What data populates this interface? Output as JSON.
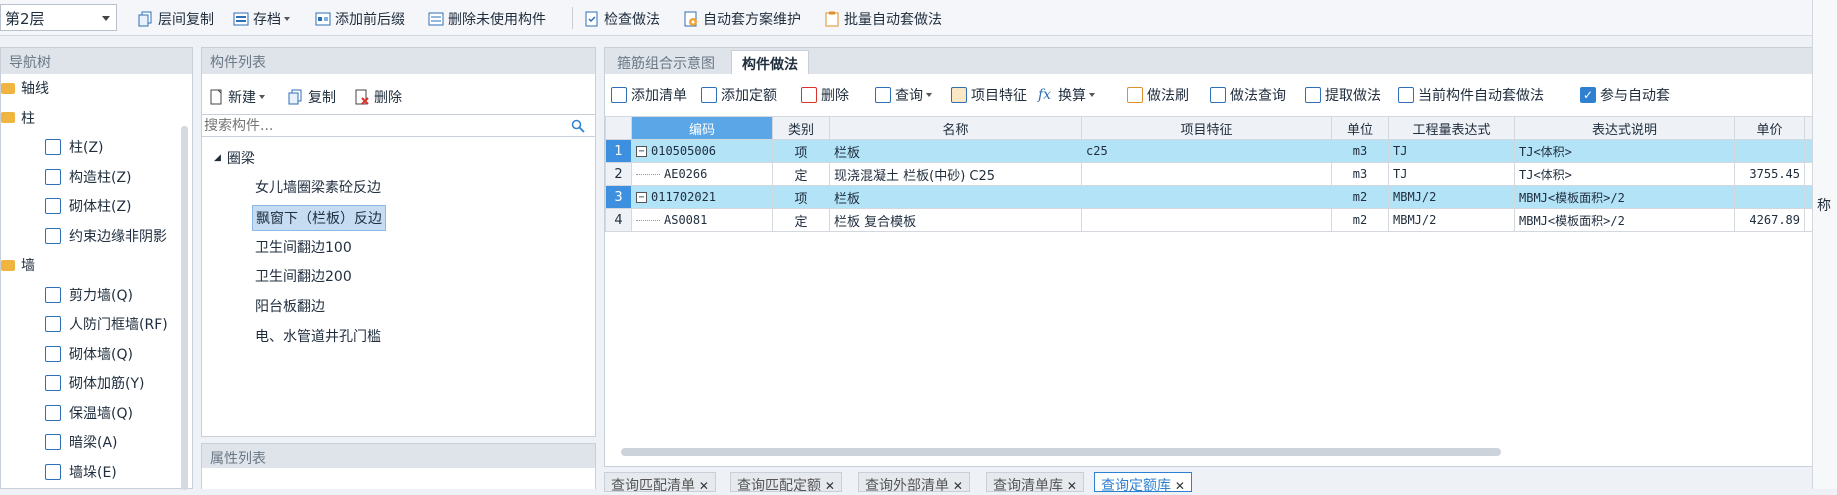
{
  "toolbar": {
    "floor": "第2层",
    "buttons": [
      "层间复制",
      "存档",
      "添加前后缀",
      "删除未使用构件",
      "检查做法",
      "自动套方案维护",
      "批量自动套做法"
    ]
  },
  "nav": {
    "title": "导航树",
    "items": [
      {
        "label": "轴线",
        "level": 0
      },
      {
        "label": "柱",
        "level": 0
      },
      {
        "label": "柱(Z)",
        "level": 1
      },
      {
        "label": "构造柱(Z)",
        "level": 1
      },
      {
        "label": "砌体柱(Z)",
        "level": 1
      },
      {
        "label": "约束边缘非阴影",
        "level": 1
      },
      {
        "label": "墙",
        "level": 0
      },
      {
        "label": "剪力墙(Q)",
        "level": 1
      },
      {
        "label": "人防门框墙(RF)",
        "level": 1
      },
      {
        "label": "砌体墙(Q)",
        "level": 1
      },
      {
        "label": "砌体加筋(Y)",
        "level": 1
      },
      {
        "label": "保温墙(Q)",
        "level": 1
      },
      {
        "label": "暗梁(A)",
        "level": 1
      },
      {
        "label": "墙垛(E)",
        "level": 1
      }
    ]
  },
  "components": {
    "title": "构件列表",
    "new_label": "新建",
    "copy_label": "复制",
    "delete_label": "删除",
    "search_placeholder": "搜索构件...",
    "group": "圈梁",
    "items": [
      "女儿墙圈梁素砼反边",
      "飘窗下（栏板）反边",
      "卫生间翻边100",
      "卫生间翻边200",
      "阳台板翻边",
      "电、水管道井孔门槛"
    ],
    "selected_index": 1,
    "props_title": "属性列表"
  },
  "main": {
    "tabs": [
      "箍筋组合示意图",
      "构件做法"
    ],
    "active_tab": 1,
    "actions": [
      "添加清单",
      "添加定额",
      "删除",
      "查询",
      "项目特征",
      "换算",
      "做法刷",
      "做法查询",
      "提取做法",
      "当前构件自动套做法",
      "参与自动套"
    ],
    "participate_auto": true,
    "columns": [
      "编码",
      "类别",
      "名称",
      "项目特征",
      "单位",
      "工程量表达式",
      "表达式说明",
      "单价"
    ],
    "rows": [
      {
        "n": "1",
        "code": "010505006",
        "type": "项",
        "name": "栏板",
        "feature": "c25",
        "unit": "m3",
        "expr": "TJ",
        "desc": "TJ<体积>",
        "price": "",
        "highlight": true,
        "parent": true
      },
      {
        "n": "2",
        "code": "AE0266",
        "type": "定",
        "name": "现浇混凝土 栏板(中砂) C25",
        "feature": "",
        "unit": "m3",
        "expr": "TJ",
        "desc": "TJ<体积>",
        "price": "3755.45",
        "highlight": false,
        "parent": false
      },
      {
        "n": "3",
        "code": "011702021",
        "type": "项",
        "name": "栏板",
        "feature": "",
        "unit": "m2",
        "expr": "MBMJ/2",
        "desc": "MBMJ<模板面积>/2",
        "price": "",
        "highlight": true,
        "parent": true
      },
      {
        "n": "4",
        "code": "AS0081",
        "type": "定",
        "name": "栏板 复合模板",
        "feature": "",
        "unit": "m2",
        "expr": "MBMJ/2",
        "desc": "MBMJ<模板面积>/2",
        "price": "4267.89",
        "highlight": false,
        "parent": false
      }
    ],
    "edge_label": "称"
  },
  "bottom_tabs": [
    "查询匹配清单",
    "查询匹配定额",
    "查询外部清单",
    "查询清单库",
    "查询定额库"
  ],
  "bottom_active": 4
}
